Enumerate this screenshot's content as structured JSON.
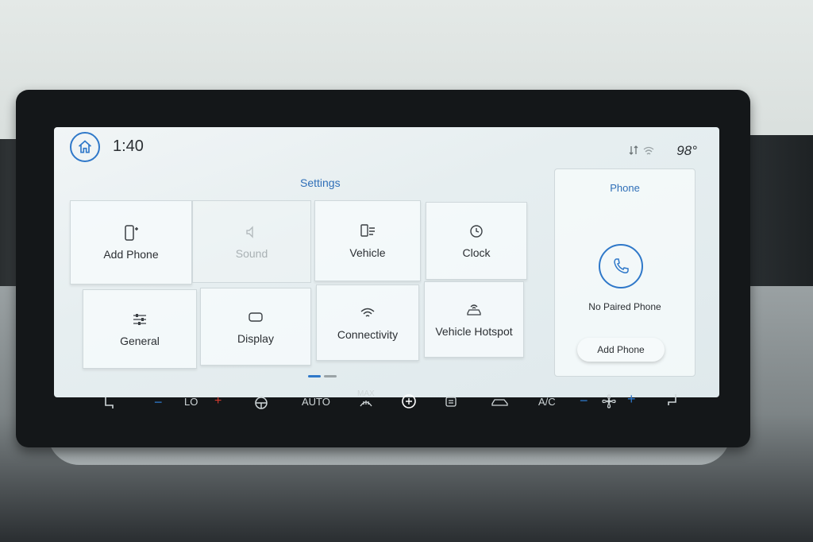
{
  "status": {
    "time": "1:40",
    "temperature": "98°"
  },
  "settings": {
    "title": "Settings",
    "tiles": [
      {
        "label": "Add Phone",
        "icon": "phone-add-icon",
        "enabled": true
      },
      {
        "label": "Sound",
        "icon": "speaker-icon",
        "enabled": false
      },
      {
        "label": "Vehicle",
        "icon": "vehicle-settings-icon",
        "enabled": true
      },
      {
        "label": "Clock",
        "icon": "clock-icon",
        "enabled": true
      },
      {
        "label": "General",
        "icon": "sliders-icon",
        "enabled": true
      },
      {
        "label": "Display",
        "icon": "display-icon",
        "enabled": true
      },
      {
        "label": "Connectivity",
        "icon": "wifi-icon",
        "enabled": true
      },
      {
        "label": "Vehicle Hotspot",
        "icon": "hotspot-icon",
        "enabled": true
      }
    ]
  },
  "phone": {
    "title": "Phone",
    "status": "No Paired Phone",
    "add_button": "Add Phone"
  },
  "climate": {
    "fan_level": "LO",
    "auto": "AUTO",
    "max_defrost": "MAX",
    "ac": "A/C"
  },
  "colors": {
    "accent": "#2f78c9",
    "heat": "#d23a2e"
  }
}
